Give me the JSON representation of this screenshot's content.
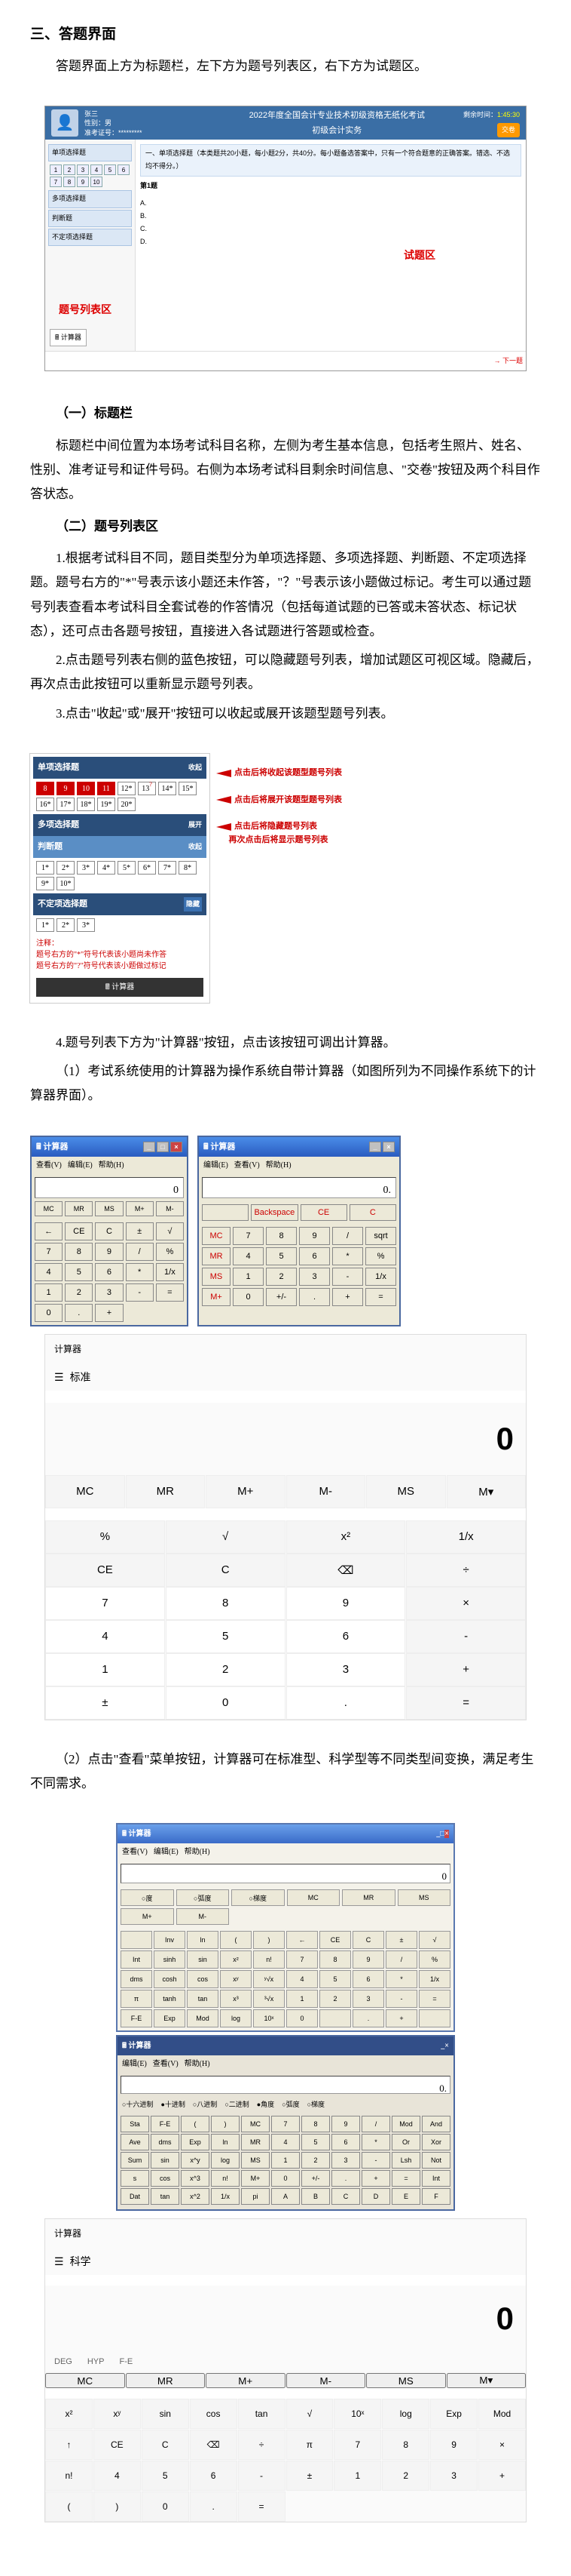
{
  "heading": "三、答题界面",
  "intro": "答题界面上方为标题栏，左下方为题号列表区，右下方为试题区。",
  "shot1": {
    "user_name": "张三",
    "user_info_line1": "性别：男",
    "user_info_line2": "准考证号：*********",
    "exam_title": "2022年度全国会计专业技术初级资格无纸化考试",
    "subject_line": "初级会计实务",
    "time_label": "剩余时间：",
    "submit": "交卷",
    "qtype1": "单项选择题",
    "qtype2": "多项选择题",
    "qtype3": "判断题",
    "qtype4": "不定项选择题",
    "calc_btn": "计算器",
    "qbar": "一、单项选择题（本类题共20小题，每小题2分，共40分。每小题备选答案中，只有一个符合题意的正确答案。错选、不选均不得分。）",
    "qstem": "第1题",
    "label_left": "题号列表区",
    "label_right": "试题区",
    "footer_btn": "→ 下一题"
  },
  "sub1_title": "（一）标题栏",
  "sub1_p1": "标题栏中间位置为本场考试科目名称，左侧为考生基本信息，包括考生照片、姓名、性别、准考证号和证件号码。右侧为本场考试科目剩余时间信息、\"交卷\"按钮及两个科目作答状态。",
  "sub2_title": "（二）题号列表区",
  "sub2_p1": "1.根据考试科目不同，题目类型分为单项选择题、多项选择题、判断题、不定项选择题。题号右方的\"*\"号表示该小题还未作答，\"？\"号表示该小题做过标记。考生可以通过题号列表查看本考试科目全套试卷的作答情况（包括每道试题的已答或未答状态、标记状态），还可点击各题号按钮，直接进入各试题进行答题或检查。",
  "sub2_p2": "2.点击题号列表右侧的蓝色按钮，可以隐藏题号列表，增加试题区可视区域。隐藏后，再次点击此按钮可以重新显示题号列表。",
  "sub2_p3": "3.点击\"收起\"或\"展开\"按钮可以收起或展开该题型题号列表。",
  "shot2": {
    "bar1": "单项选择题",
    "collapse": "收起",
    "expand": "展开",
    "bar2": "多项选择题",
    "bar3": "判断题",
    "bar4": "不定项选择题",
    "note_title": "注释：",
    "note1": "题号右方的\"*\"符号代表该小题尚未作答",
    "note2": "题号右方的\"?\"符号代表该小题做过标记",
    "calc": "计算器",
    "arrow1": "点击后将收起该题型题号列表",
    "arrow2": "点击后将展开该题型题号列表",
    "arrow3a": "点击后将隐藏题号列表",
    "arrow3b": "再次点击后将显示题号列表"
  },
  "sub2_p4": "4.题号列表下方为\"计算器\"按钮，点击该按钮可调出计算器。",
  "sub2_p5": "（1）考试系统使用的计算器为操作系统自带计算器（如图所列为不同操作系统下的计算器界面）。",
  "calcA": {
    "title": "计算器",
    "menu_view": "查看(V)",
    "menu_edit": "编辑(E)",
    "menu_help": "帮助(H)",
    "display": "0",
    "mem": [
      "MC",
      "MR",
      "MS",
      "M+",
      "M-"
    ],
    "keys": [
      "←",
      "CE",
      "C",
      "±",
      "√",
      "7",
      "8",
      "9",
      "/",
      "%",
      "4",
      "5",
      "6",
      "*",
      "1/x",
      "1",
      "2",
      "3",
      "-",
      "=",
      "0",
      ".",
      "+"
    ]
  },
  "calcB": {
    "title": "计算器",
    "menu_edit": "编辑(E)",
    "menu_view": "查看(V)",
    "menu_help": "帮助(H)",
    "display": "0.",
    "top": [
      "",
      "Backspace",
      "CE",
      "C"
    ],
    "rows": [
      [
        "MC",
        "7",
        "8",
        "9",
        "/",
        "sqrt"
      ],
      [
        "MR",
        "4",
        "5",
        "6",
        "*",
        "%"
      ],
      [
        "MS",
        "1",
        "2",
        "3",
        "-",
        "1/x"
      ],
      [
        "M+",
        "0",
        "+/-",
        ".",
        "+",
        "="
      ]
    ]
  },
  "moderncalc": {
    "title": "计算器",
    "mode": "标准",
    "display": "0",
    "mem": [
      "MC",
      "MR",
      "M+",
      "M-",
      "MS",
      "M▾"
    ],
    "row1": [
      "%",
      "√",
      "x²",
      "1/x"
    ],
    "row2": [
      "CE",
      "C",
      "⌫",
      "÷"
    ],
    "rows_num": [
      [
        "7",
        "8",
        "9",
        "×"
      ],
      [
        "4",
        "5",
        "6",
        "-"
      ],
      [
        "1",
        "2",
        "3",
        "+"
      ],
      [
        "±",
        "0",
        ".",
        "="
      ]
    ]
  },
  "sub2_p6": "（2）点击\"查看\"菜单按钮，计算器可在标准型、科学型等不同类型间变换，满足考生不同需求。",
  "scicalc": {
    "title": "计算器",
    "menu_view": "查看(V)",
    "menu_edit": "编辑(E)",
    "menu_help": "帮助(H)",
    "display": "0",
    "moderow": [
      "○度",
      "○弧度",
      "○梯度",
      "MC",
      "MR",
      "MS",
      "M+",
      "M-"
    ],
    "grid": [
      [
        "",
        "Inv",
        "ln",
        "(",
        ")",
        "←",
        "CE",
        "C",
        "±",
        "√"
      ],
      [
        "Int",
        "sinh",
        "sin",
        "x²",
        "n!",
        "7",
        "8",
        "9",
        "/",
        "%"
      ],
      [
        "dms",
        "cosh",
        "cos",
        "xʸ",
        "ʸ√x",
        "4",
        "5",
        "6",
        "*",
        "1/x"
      ],
      [
        "π",
        "tanh",
        "tan",
        "x³",
        "³√x",
        "1",
        "2",
        "3",
        "-",
        "="
      ],
      [
        "F-E",
        "Exp",
        "Mod",
        "log",
        "10ˣ",
        "0",
        "",
        ".",
        "+",
        ""
      ]
    ]
  },
  "scicalc2": {
    "title": "计算器",
    "menu_edit": "编辑(E)",
    "menu_view": "查看(V)",
    "menu_help": "帮助(H)",
    "display": "0.",
    "radios": [
      "○十六进制",
      "●十进制",
      "○八进制",
      "○二进制",
      "●角度",
      "○弧度",
      "○梯度"
    ],
    "grid": [
      [
        "Sta",
        "F-E",
        "(",
        ")",
        "MC",
        "7",
        "8",
        "9",
        "/",
        "Mod",
        "And"
      ],
      [
        "Ave",
        "dms",
        "Exp",
        "ln",
        "MR",
        "4",
        "5",
        "6",
        "*",
        "Or",
        "Xor"
      ],
      [
        "Sum",
        "sin",
        "x^y",
        "log",
        "MS",
        "1",
        "2",
        "3",
        "-",
        "Lsh",
        "Not"
      ],
      [
        "s",
        "cos",
        "x^3",
        "n!",
        "M+",
        "0",
        "+/-",
        ".",
        "+",
        "=",
        "Int"
      ],
      [
        "Dat",
        "tan",
        "x^2",
        "1/x",
        "pi",
        "A",
        "B",
        "C",
        "D",
        "E",
        "F"
      ]
    ]
  },
  "modsci": {
    "title": "计算器",
    "mode": "科学",
    "display": "0",
    "deg": [
      "DEG",
      "HYP",
      "F-E"
    ],
    "mem": [
      "MC",
      "MR",
      "M+",
      "M-",
      "MS",
      "M▾"
    ],
    "grid": [
      [
        "x²",
        "xʸ",
        "sin",
        "cos",
        "tan",
        "√",
        "10ˣ",
        "log",
        "Exp",
        "Mod"
      ],
      [
        "↑",
        "CE",
        "C",
        "⌫",
        "÷",
        "π",
        "7",
        "8",
        "9",
        "×"
      ],
      [
        "n!",
        "4",
        "5",
        "6",
        "-",
        "±",
        "1",
        "2",
        "3",
        "+"
      ],
      [
        "(",
        ")",
        "0",
        ".",
        "="
      ]
    ]
  }
}
